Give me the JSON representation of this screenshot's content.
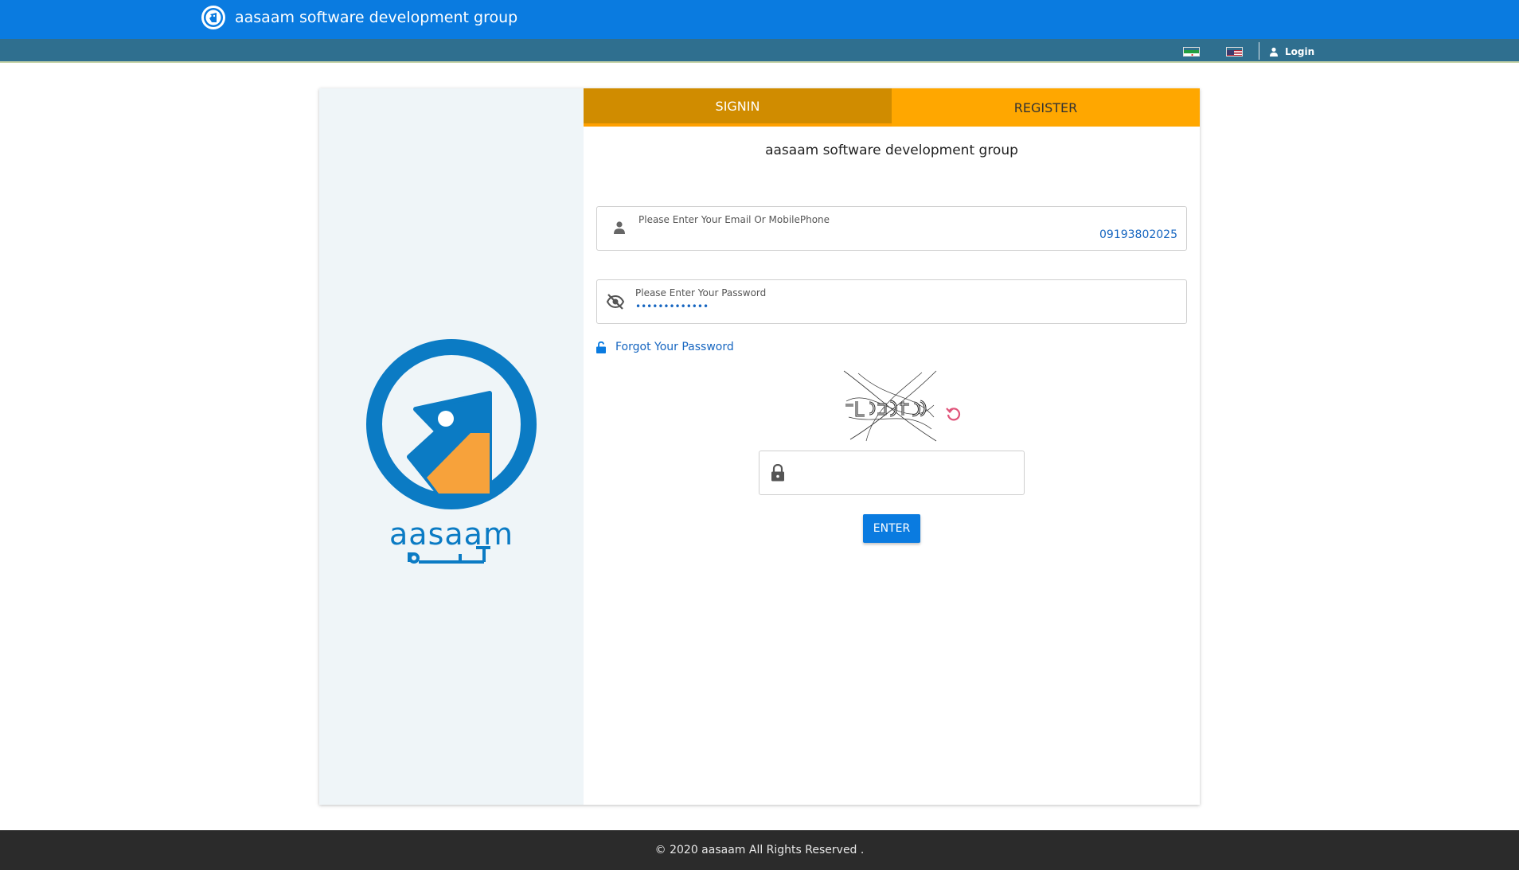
{
  "header": {
    "brand_title": "aasaam software development group",
    "login_label": "Login",
    "languages": [
      {
        "code": "fa",
        "icon": "iran-flag-icon"
      },
      {
        "code": "en",
        "icon": "us-flag-icon"
      }
    ]
  },
  "tabs": {
    "signin_label": "SIGNIN",
    "register_label": "REGISTER",
    "active": "signin"
  },
  "form": {
    "title": "aasaam software development group",
    "username_label": "Please Enter Your Email Or MobilePhone",
    "username_value": "09193802025",
    "password_label": "Please Enter Your Password",
    "password_value": "•••••••••••••",
    "forgot_label": "Forgot Your Password",
    "captcha_value": "",
    "submit_label": "ENTER"
  },
  "logo": {
    "latin_text": "aasaam"
  },
  "footer": {
    "text": "© 2020 aasaam All Rights Reserved ."
  },
  "colors": {
    "primary": "#0a7be0",
    "subbar": "#2f6f8f",
    "tab_active": "#d08c00",
    "tab_inactive": "#ffa700",
    "logo_blue": "#0b7bc4",
    "logo_orange": "#f7a23b",
    "refresh": "#e0557a",
    "footer": "#2b2b2b"
  }
}
